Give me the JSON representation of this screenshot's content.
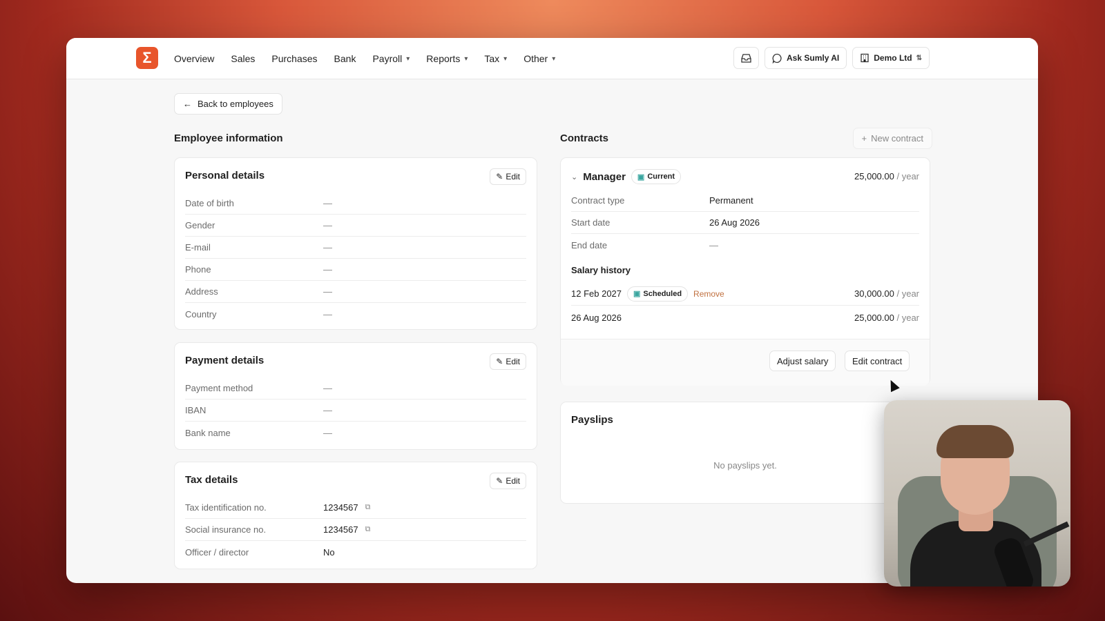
{
  "nav": {
    "logo_glyph": "Σ",
    "items": [
      {
        "label": "Overview",
        "has_menu": false
      },
      {
        "label": "Sales",
        "has_menu": false
      },
      {
        "label": "Purchases",
        "has_menu": false
      },
      {
        "label": "Bank",
        "has_menu": false
      },
      {
        "label": "Payroll",
        "has_menu": true
      },
      {
        "label": "Reports",
        "has_menu": true
      },
      {
        "label": "Tax",
        "has_menu": true
      },
      {
        "label": "Other",
        "has_menu": true
      }
    ],
    "ask_ai_label": "Ask Sumly AI",
    "company_label": "Demo Ltd"
  },
  "back_label": "Back to employees",
  "employee_info": {
    "title": "Employee information",
    "edit_label": "Edit",
    "personal": {
      "title": "Personal details",
      "rows": [
        {
          "label": "Date of birth",
          "value": "—"
        },
        {
          "label": "Gender",
          "value": "—"
        },
        {
          "label": "E-mail",
          "value": "—"
        },
        {
          "label": "Phone",
          "value": "—"
        },
        {
          "label": "Address",
          "value": "—"
        },
        {
          "label": "Country",
          "value": "—"
        }
      ]
    },
    "payment": {
      "title": "Payment details",
      "rows": [
        {
          "label": "Payment method",
          "value": "—"
        },
        {
          "label": "IBAN",
          "value": "—"
        },
        {
          "label": "Bank name",
          "value": "—"
        }
      ]
    },
    "tax": {
      "title": "Tax details",
      "rows": [
        {
          "label": "Tax identification no.",
          "value": "1234567"
        },
        {
          "label": "Social insurance no.",
          "value": "1234567"
        },
        {
          "label": "Officer / director",
          "value": "No"
        }
      ]
    }
  },
  "contracts": {
    "title": "Contracts",
    "new_contract_label": "New contract",
    "contract": {
      "role": "Manager",
      "status": "Current",
      "salary": "25,000.00",
      "unit": "/ year",
      "rows": [
        {
          "label": "Contract type",
          "value": "Permanent"
        },
        {
          "label": "Start date",
          "value": "26 Aug 2026"
        },
        {
          "label": "End date",
          "value": "—"
        }
      ],
      "salary_history_title": "Salary history",
      "history": [
        {
          "date": "12 Feb 2027",
          "badge": "Scheduled",
          "action": "Remove",
          "amount": "30,000.00",
          "unit": "/ year"
        },
        {
          "date": "26 Aug 2026",
          "amount": "25,000.00",
          "unit": "/ year"
        }
      ],
      "adjust_label": "Adjust salary",
      "edit_label": "Edit contract"
    }
  },
  "payslips": {
    "title": "Payslips",
    "empty_text": "No payslips yet."
  },
  "colors": {
    "brand": "#e8552b",
    "remove": "#c0703f",
    "badge_icon": "#3aa6a0"
  }
}
